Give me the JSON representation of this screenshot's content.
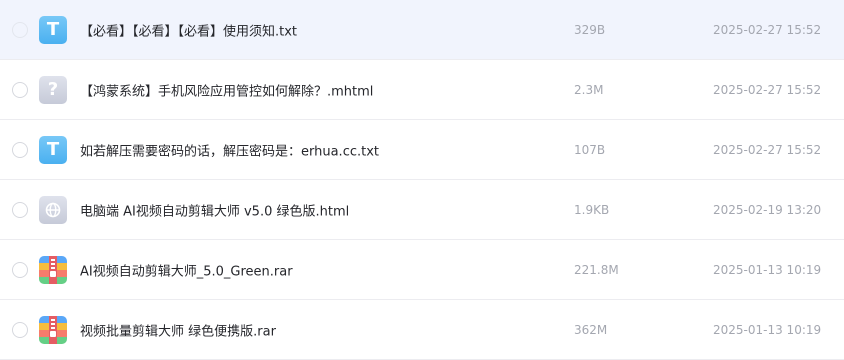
{
  "files": [
    {
      "icon": "txt-file-icon",
      "icon_letter": "T",
      "name": "【必看】【必看】【必看】使用须知.txt",
      "size": "329B",
      "date": "2025-02-27 15:52"
    },
    {
      "icon": "unknown-file-icon",
      "icon_letter": "?",
      "name": "【鸿蒙系统】手机风险应用管控如何解除？.mhtml",
      "size": "2.3M",
      "date": "2025-02-27 15:52"
    },
    {
      "icon": "txt-file-icon",
      "icon_letter": "T",
      "name": "如若解压需要密码的话，解压密码是：erhua.cc.txt",
      "size": "107B",
      "date": "2025-02-27 15:52"
    },
    {
      "icon": "html-file-icon",
      "icon_letter": "",
      "name": "电脑端 AI视频自动剪辑大师 v5.0 绿色版.html",
      "size": "1.9KB",
      "date": "2025-02-19 13:20"
    },
    {
      "icon": "rar-archive-icon",
      "icon_letter": "",
      "name": "AI视频自动剪辑大师_5.0_Green.rar",
      "size": "221.8M",
      "date": "2025-01-13 10:19"
    },
    {
      "icon": "rar-archive-icon",
      "icon_letter": "",
      "name": "视频批量剪辑大师 绿色便携版.rar",
      "size": "362M",
      "date": "2025-01-13 10:19"
    }
  ],
  "colors": {
    "hover_row_bg": "#f1f4fd",
    "txt_icon": "#4ab0f0",
    "unknown_icon": "#c6cad8",
    "text_primary": "#25262b",
    "text_secondary": "#a4a7b0"
  }
}
